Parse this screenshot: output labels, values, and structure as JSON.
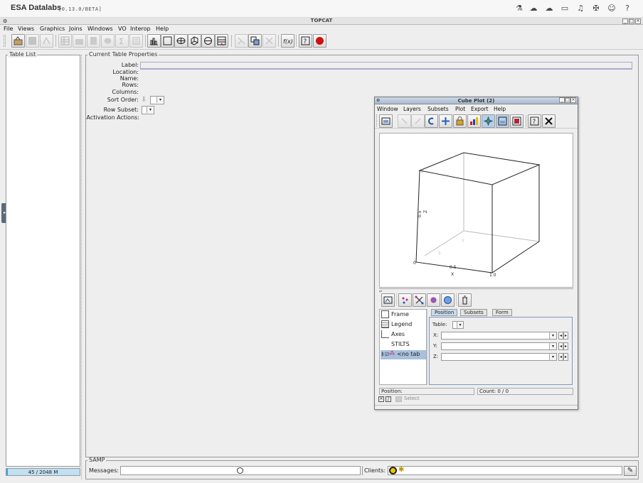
{
  "esa": {
    "title": "ESA Datalabs",
    "version": "[0.13.0/BETA]",
    "icons": [
      "flask-icon",
      "datalab-icon",
      "cloud-icon",
      "folder-icon",
      "bell-icon",
      "satellite-icon",
      "user-icon",
      "help-icon"
    ]
  },
  "window": {
    "title": "TOPCAT"
  },
  "menu": [
    "File",
    "Views",
    "Graphics",
    "Joins",
    "Windows",
    "VO",
    "Interop",
    "Help"
  ],
  "table_list": {
    "label": "Table List"
  },
  "memory": {
    "text": "45 / 2048 M",
    "fraction": 0.022
  },
  "properties": {
    "label": "Current Table Properties",
    "fields": [
      "Label:",
      "Location:",
      "Name:",
      "Rows:",
      "Columns:",
      "Sort Order:",
      "Row Subset:",
      "Activation Actions:"
    ]
  },
  "samp": {
    "label": "SAMP",
    "messages_label": "Messages:",
    "clients_label": "Clients:"
  },
  "cube_plot": {
    "title": "Cube Plot (2)",
    "menu": [
      "Window",
      "Layers",
      "Subsets",
      "Plot",
      "Export",
      "Help"
    ],
    "axes": {
      "x_label": "X",
      "y_label": "Y",
      "z_label": "Z",
      "x_ticks": [
        "0",
        "0.5",
        "1.0"
      ],
      "z_ticks": [
        "0.5"
      ],
      "y_ticks": [
        "0",
        "1"
      ]
    },
    "layers": [
      "Frame",
      "Legend",
      "Axes",
      "STILTS",
      "<no tab"
    ],
    "tabs": [
      "Position",
      "Subsets",
      "Form"
    ],
    "position": {
      "table_label": "Table:",
      "x_label": "X:",
      "y_label": "Y:",
      "z_label": "Z:"
    },
    "status": {
      "position_label": "Position:",
      "count": "Count: 0 / 0"
    },
    "select_label": "Select"
  }
}
